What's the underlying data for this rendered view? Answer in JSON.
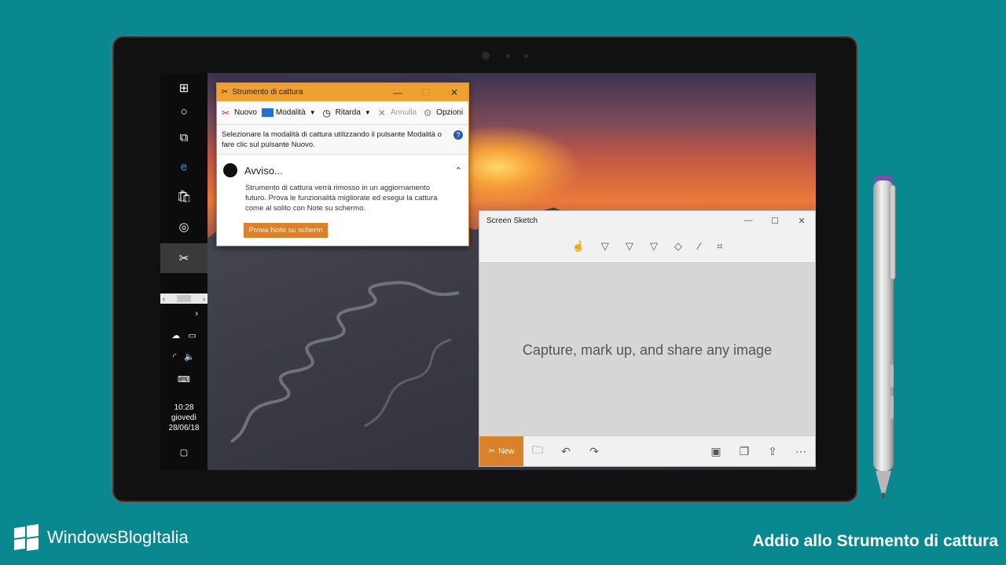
{
  "snipping_tool": {
    "title": "Strumento di cattura",
    "toolbar": {
      "new": "Nuovo",
      "mode": "Modalità",
      "delay": "Ritarda",
      "cancel": "Annulla",
      "options": "Opzioni"
    },
    "info": "Selezionare la modalità di cattura utilizzando il pulsante Modalità o fare clic sul pulsante Nuovo.",
    "notice_title": "Avviso...",
    "notice_body": "Strumento di cattura verrà rimosso in un aggiornamento futuro. Prova le funzionalità migliorate ed esegui la cattura come al solito con Note su schermo.",
    "notice_button": "Prova Note su scherm"
  },
  "screen_sketch": {
    "title": "Screen Sketch",
    "canvas_text": "Capture, mark up, and share any image",
    "new_button": "New"
  },
  "taskbar": {
    "time": "10:28",
    "day": "giovedì",
    "date": "28/06/18"
  },
  "branding": {
    "name": "WindowsBlogItalia",
    "headline": "Addio allo Strumento di cattura"
  },
  "colors": {
    "background": "#09898f",
    "accent": "#d9822b",
    "snip_title": "#f0a030"
  }
}
